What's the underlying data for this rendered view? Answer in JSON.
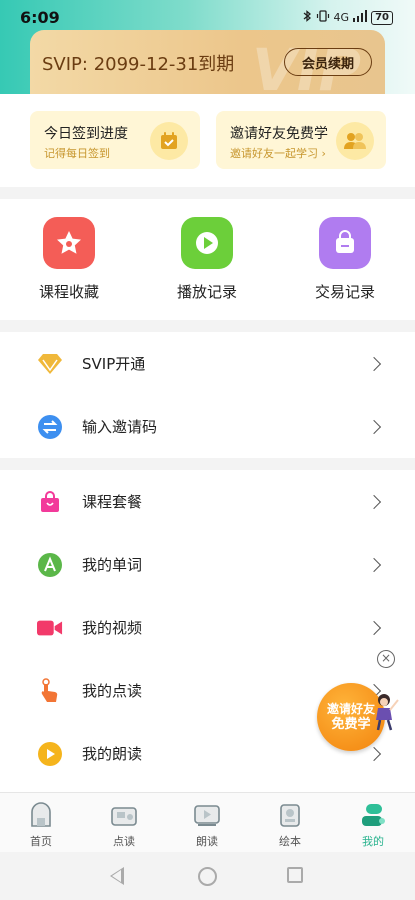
{
  "status_bar": {
    "time": "6:09",
    "signal": "4G",
    "battery": "70"
  },
  "header": {
    "svip_text": "SVIP: 2099-12-31到期",
    "renew_button": "会员续期",
    "watermark": "VIP"
  },
  "quick_cards": [
    {
      "title": "今日签到进度",
      "subtitle": "记得每日签到",
      "icon": "calendar-check-icon"
    },
    {
      "title": "邀请好友免费学",
      "subtitle": "邀请好友一起学习 ›",
      "icon": "friends-icon"
    }
  ],
  "shortcuts": [
    {
      "label": "课程收藏",
      "icon": "star-icon",
      "color": "#f45d57"
    },
    {
      "label": "播放记录",
      "icon": "play-icon",
      "color": "#6ccf3a"
    },
    {
      "label": "交易记录",
      "icon": "bag-icon",
      "color": "#b07cf0"
    }
  ],
  "menu_group1": [
    {
      "label": "SVIP开通",
      "icon": "diamond-icon"
    },
    {
      "label": "输入邀请码",
      "icon": "exchange-icon"
    }
  ],
  "menu_group2": [
    {
      "label": "课程套餐",
      "icon": "shopping-bag-icon"
    },
    {
      "label": "我的单词",
      "icon": "letter-a-icon"
    },
    {
      "label": "我的视频",
      "icon": "video-camera-icon"
    },
    {
      "label": "我的点读",
      "icon": "pointing-hand-icon"
    },
    {
      "label": "我的朗读",
      "icon": "play-circle-icon"
    }
  ],
  "floating_invite": {
    "line1": "邀请好友",
    "line2": "免费学",
    "close": "×"
  },
  "tabbar": [
    {
      "label": "首页",
      "icon": "home-icon"
    },
    {
      "label": "点读",
      "icon": "read-point-icon"
    },
    {
      "label": "朗读",
      "icon": "read-aloud-icon"
    },
    {
      "label": "绘本",
      "icon": "picture-book-icon"
    },
    {
      "label": "我的",
      "icon": "profile-icon",
      "active": true
    }
  ]
}
